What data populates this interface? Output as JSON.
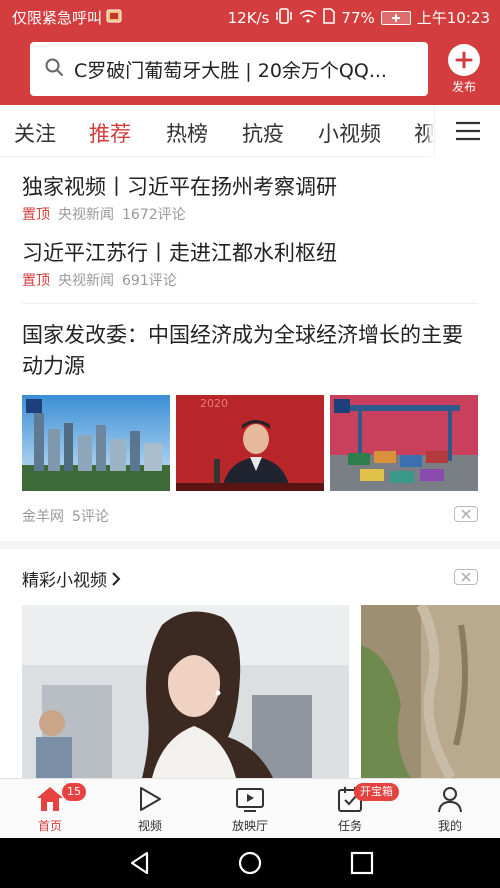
{
  "status_bar": {
    "left_text": "仅限紧急呼叫",
    "net_speed": "12K/s",
    "battery": "77%",
    "time": "上午10:23"
  },
  "search": {
    "query": "C罗破门葡萄牙大胜 | 20余万个QQ..."
  },
  "publish_label": "发布",
  "tabs": [
    "关注",
    "推荐",
    "热榜",
    "抗疫",
    "小视频",
    "视"
  ],
  "active_tab": "推荐",
  "feed": {
    "item1": {
      "title": "独家视频丨习近平在扬州考察调研",
      "pin": "置顶",
      "source": "央视新闻",
      "comments": "1672评论"
    },
    "item2": {
      "title": "习近平江苏行丨走进江都水利枢纽",
      "pin": "置顶",
      "source": "央视新闻",
      "comments": "691评论"
    },
    "item3": {
      "title": "国家发改委：中国经济成为全球经济增长的主要动力源",
      "source": "金羊网",
      "comments": "5评论"
    }
  },
  "short_video_section": {
    "title": "精彩小视频"
  },
  "bottom_nav": {
    "home": "首页",
    "video": "视频",
    "theater": "放映厅",
    "tasks": "任务",
    "me": "我的",
    "home_badge": "15",
    "tasks_badge": "开宝箱"
  },
  "colors": {
    "accent": "#d43d3d",
    "badge": "#e64340"
  }
}
